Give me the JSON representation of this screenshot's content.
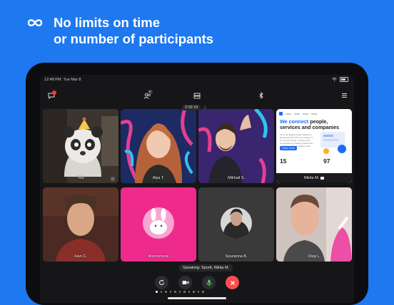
{
  "promo": {
    "icon": "infinity-icon",
    "line1": "No limits on time",
    "line2": "or number of participants"
  },
  "status_bar": {
    "time": "12:48 PM",
    "date": "Tue Mar 8"
  },
  "toolbar": {
    "participants_count": "9"
  },
  "call": {
    "timer": "2:02:19"
  },
  "participants": [
    {
      "name": "You"
    },
    {
      "name": "Alya T."
    },
    {
      "name": "Mikhail S."
    },
    {
      "name": "Nikita M."
    },
    {
      "name": "Ivan C."
    },
    {
      "name": "Anonymous"
    },
    {
      "name": "Syuzanna B."
    },
    {
      "name": "Oleg L."
    }
  ],
  "shared_screen": {
    "headline_blue": "We connect",
    "headline_rest1": " people,",
    "headline_rest2": "services and companies",
    "body": "VK is the largest social network in Russia and the CIS. Our mission is to connect people, services and companies by creating simple and convenient communication tools.",
    "button": "Learn more",
    "stat1": "15",
    "stat2": "97"
  },
  "speaking": "Speaking: Sportt, Nikita M.",
  "colors": {
    "background": "#1e78f0",
    "active_border": "#57d46a",
    "end_call": "#ff4d4f",
    "tile_pink": "#ee2a8c"
  }
}
